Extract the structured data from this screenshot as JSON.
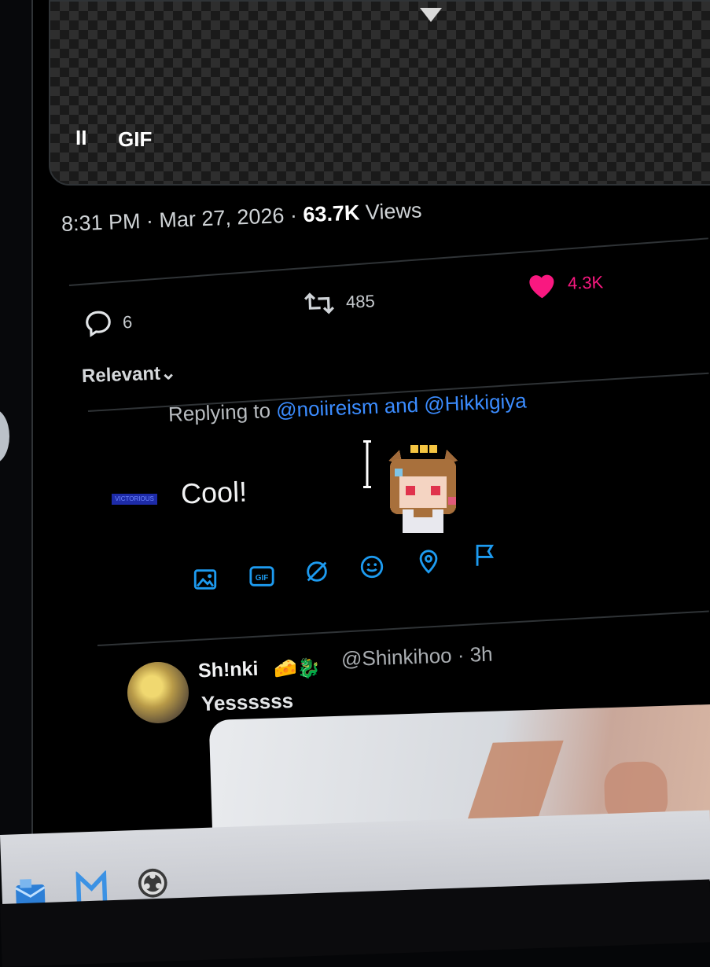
{
  "media": {
    "pause_label": "II",
    "gif_label": "GIF"
  },
  "post": {
    "time": "8:31 PM",
    "date": "Mar 27, 2026",
    "views_count": "63.7K",
    "views_label": "Views",
    "replies": "6",
    "reposts": "485",
    "likes": "4.3K"
  },
  "sort": {
    "label": "Relevant"
  },
  "composer": {
    "replying_prefix": "Replying to",
    "mention1": "@noiireism",
    "and": "and",
    "mention2": "@Hikkigiya",
    "text": "Cool!",
    "avatar_text": "VICTORIOUS",
    "tools": [
      "image-icon",
      "gif-icon",
      "poll-icon",
      "emoji-icon",
      "location-icon",
      "flag-icon"
    ]
  },
  "reply": {
    "name": "Sh!nki",
    "emojis": "🧀🐉",
    "handle": "@Shinkihoo · 3h",
    "text": "Yessssss"
  },
  "sidebar": {
    "more": "•••"
  },
  "colors": {
    "accent": "#1d9bf0",
    "like": "#f91880",
    "mention": "#3b8cff"
  }
}
